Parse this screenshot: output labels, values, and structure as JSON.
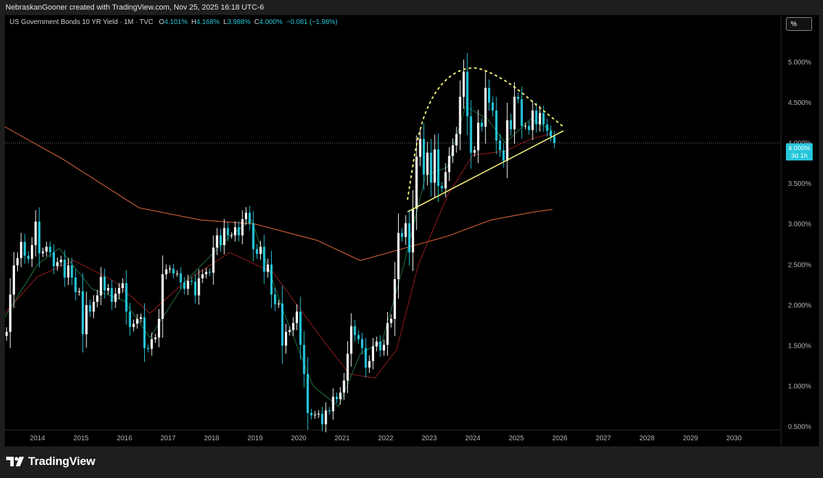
{
  "header": {
    "credit": "NebraskanGooner created with TradingView.com, Nov 25, 2025 16:18 UTC-6"
  },
  "legend": {
    "symbol": "US Government Bonds 10 YR Yield · 1M · TVC",
    "open_label": "O",
    "open": "4.101%",
    "high_label": "H",
    "high": "4.168%",
    "low_label": "L",
    "low": "3.988%",
    "close_label": "C",
    "close": "4.000%",
    "change": "−0.081 (−1.98%)"
  },
  "scale_button": "%",
  "price_badge": {
    "value": "4.000%",
    "countdown": "3d 1h"
  },
  "footer": {
    "brand": "TradingView"
  },
  "colors": {
    "background": "#000000",
    "up": "#ffffff",
    "down": "#26c6da",
    "ma_long": "#d9633b",
    "ma_mid": "#8b1a1a",
    "ma_short": "#1f6b3a",
    "trendline": "#f5f07a"
  },
  "chart_data": {
    "type": "candlestick",
    "title": "US Government Bonds 10 YR Yield · 1M · TVC",
    "xlabel": "",
    "ylabel": "",
    "x_ticks": [
      "2014",
      "2015",
      "2016",
      "2017",
      "2018",
      "2019",
      "2020",
      "2021",
      "2022",
      "2023",
      "2024",
      "2025",
      "2026",
      "2027",
      "2028",
      "2029",
      "2030"
    ],
    "y_ticks": [
      "0.500%",
      "1.000%",
      "1.500%",
      "2.000%",
      "2.500%",
      "3.000%",
      "3.500%",
      "4.000%",
      "4.500%",
      "5.000%"
    ],
    "ylim": [
      0.4,
      5.4
    ],
    "xlim": [
      "2013-04",
      "2031-02"
    ],
    "grid": false,
    "series": [
      {
        "kind": "ohlc_close",
        "start": "2013-04",
        "interval": "1M",
        "values": [
          1.67,
          2.13,
          2.49,
          2.58,
          2.78,
          2.61,
          2.57,
          2.74,
          3.03,
          2.64,
          2.66,
          2.72,
          2.65,
          2.48,
          2.53,
          2.56,
          2.34,
          2.49,
          2.34,
          2.16,
          2.17,
          1.64,
          2.0,
          1.92,
          2.04,
          2.12,
          2.35,
          2.18,
          2.21,
          2.04,
          2.14,
          2.21,
          2.27,
          1.92,
          1.73,
          1.77,
          1.83,
          1.85,
          1.47,
          1.46,
          1.58,
          1.6,
          1.83,
          2.38,
          2.44,
          2.45,
          2.39,
          2.39,
          2.28,
          2.2,
          2.3,
          2.29,
          2.12,
          2.33,
          2.38,
          2.41,
          2.4,
          2.71,
          2.86,
          2.74,
          2.95,
          2.86,
          2.86,
          2.96,
          2.86,
          3.06,
          3.14,
          3.01,
          2.69,
          2.63,
          2.72,
          2.41,
          2.5,
          2.13,
          2.01,
          2.02,
          1.5,
          1.67,
          1.69,
          1.78,
          1.92,
          1.51,
          1.15,
          0.67,
          0.64,
          0.65,
          0.66,
          0.53,
          0.7,
          0.69,
          0.87,
          0.84,
          0.92,
          1.07,
          1.4,
          1.74,
          1.63,
          1.58,
          1.47,
          1.23,
          1.31,
          1.49,
          1.55,
          1.44,
          1.51,
          1.78,
          1.83,
          2.32,
          2.89,
          2.84,
          3.01,
          2.65,
          3.19,
          3.83,
          4.05,
          3.61,
          3.88,
          3.51,
          3.92,
          3.47,
          3.44,
          3.64,
          3.84,
          3.97,
          4.11,
          4.57,
          4.88,
          4.33,
          3.88,
          3.91,
          4.25,
          4.2,
          4.68,
          4.5,
          4.4,
          4.03,
          3.91,
          3.78,
          4.28,
          4.17,
          4.57,
          4.54,
          4.21,
          4.21,
          4.16,
          4.4,
          4.23,
          4.37,
          4.23,
          4.15,
          4.08,
          4.0
        ]
      },
      {
        "name": "",
        "kind": "moving_average",
        "color": "#d9633b",
        "points": [
          [
            "2013-04",
            4.2
          ],
          [
            "2014-08",
            3.8
          ],
          [
            "2016-05",
            3.2
          ],
          [
            "2017-10",
            3.05
          ],
          [
            "2019-01",
            3.0
          ],
          [
            "2020-06",
            2.8
          ],
          [
            "2021-06",
            2.55
          ],
          [
            "2022-06",
            2.7
          ],
          [
            "2023-06",
            2.85
          ],
          [
            "2024-06",
            3.05
          ],
          [
            "2025-06",
            3.15
          ],
          [
            "2025-11",
            3.18
          ]
        ]
      },
      {
        "name": "",
        "kind": "moving_average",
        "color": "#8b1a1a",
        "points": [
          [
            "2013-04",
            1.9
          ],
          [
            "2014-01",
            2.35
          ],
          [
            "2014-11",
            2.55
          ],
          [
            "2015-10",
            2.3
          ],
          [
            "2016-08",
            1.9
          ],
          [
            "2017-06",
            2.3
          ],
          [
            "2018-06",
            2.65
          ],
          [
            "2019-06",
            2.4
          ],
          [
            "2020-08",
            1.55
          ],
          [
            "2021-03",
            1.15
          ],
          [
            "2021-10",
            1.1
          ],
          [
            "2022-04",
            1.45
          ],
          [
            "2022-10",
            2.5
          ],
          [
            "2023-06",
            3.35
          ],
          [
            "2024-01",
            3.85
          ],
          [
            "2024-10",
            3.9
          ],
          [
            "2025-05",
            4.05
          ],
          [
            "2025-11",
            4.12
          ]
        ]
      },
      {
        "name": "",
        "kind": "moving_average",
        "color": "#1f6b3a",
        "points": [
          [
            "2013-04",
            1.85
          ],
          [
            "2014-01",
            2.5
          ],
          [
            "2014-07",
            2.7
          ],
          [
            "2015-04",
            2.2
          ],
          [
            "2016-01",
            2.05
          ],
          [
            "2016-08",
            1.6
          ],
          [
            "2017-06",
            2.3
          ],
          [
            "2018-06",
            2.85
          ],
          [
            "2018-12",
            3.05
          ],
          [
            "2019-09",
            1.9
          ],
          [
            "2020-05",
            1.0
          ],
          [
            "2020-12",
            0.75
          ],
          [
            "2021-06",
            1.4
          ],
          [
            "2021-12",
            1.55
          ],
          [
            "2022-06",
            2.5
          ],
          [
            "2022-12",
            3.6
          ],
          [
            "2023-06",
            3.7
          ],
          [
            "2023-11",
            4.45
          ],
          [
            "2024-05",
            4.3
          ],
          [
            "2024-10",
            4.0
          ],
          [
            "2025-05",
            4.3
          ],
          [
            "2025-11",
            4.15
          ]
        ]
      },
      {
        "name": "",
        "kind": "trendline",
        "color": "#f5f07a",
        "points": [
          [
            "2022-07",
            3.15
          ],
          [
            "2026-02",
            4.15
          ]
        ]
      },
      {
        "name": "",
        "kind": "dashed_arc",
        "color": "#f5f07a",
        "points": [
          [
            "2022-07",
            3.3
          ],
          [
            "2022-10",
            4.15
          ],
          [
            "2023-02",
            4.6
          ],
          [
            "2023-07",
            4.85
          ],
          [
            "2024-01",
            4.95
          ],
          [
            "2024-07",
            4.85
          ],
          [
            "2025-01",
            4.68
          ],
          [
            "2025-07",
            4.45
          ],
          [
            "2026-02",
            4.2
          ]
        ]
      }
    ],
    "current_price_line": 4.0
  }
}
